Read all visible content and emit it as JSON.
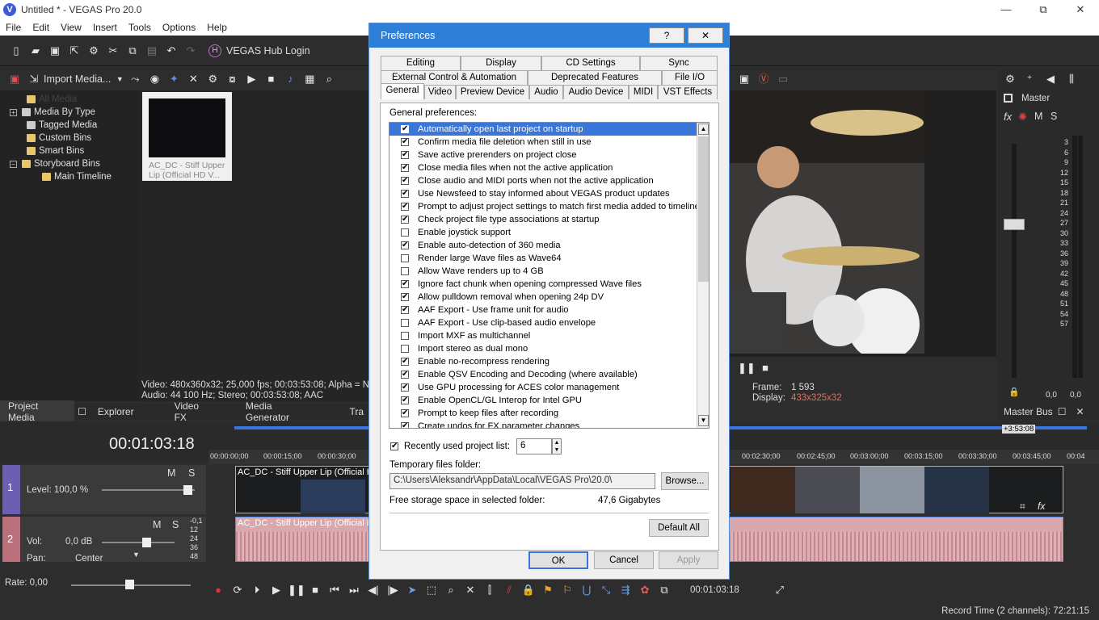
{
  "window": {
    "title": "Untitled * - VEGAS Pro 20.0",
    "logo": "V",
    "minimize": "—",
    "maximize": "⧉",
    "close": "✕"
  },
  "menu": [
    "File",
    "Edit",
    "View",
    "Insert",
    "Tools",
    "Options",
    "Help"
  ],
  "toolbar": {
    "hub_login": "VEGAS Hub Login",
    "hub_icon": "H"
  },
  "project_media": {
    "import_label": "Import Media...",
    "tree": [
      {
        "label": "All Media",
        "type": "folder",
        "indent": 0
      },
      {
        "label": "Media By Type",
        "type": "expand",
        "indent": 0
      },
      {
        "label": "Tagged Media",
        "type": "folder",
        "indent": 0
      },
      {
        "label": "Custom Bins",
        "type": "folder",
        "indent": 0
      },
      {
        "label": "Smart Bins",
        "type": "folder",
        "indent": 0
      },
      {
        "label": "Storyboard Bins",
        "type": "collapse",
        "indent": 0
      },
      {
        "label": "Main Timeline",
        "type": "folder",
        "indent": 1
      }
    ],
    "thumb_caption": "AC_DC - Stiff Upper Lip (Official HD V...",
    "info_video": "Video: 480x360x32; 25,000 fps; 00:03:53:08; Alpha = No",
    "info_audio": "Audio: 44 100 Hz; Stereo; 00:03:53:08; AAC"
  },
  "bottom_tabs": [
    "Project Media",
    "Explorer",
    "Video FX",
    "Media Generator",
    "Tra"
  ],
  "preview": {
    "frame_label": "Frame:",
    "frame_value": "1 593",
    "display_label": "Display:",
    "display_value": "433x325x32"
  },
  "mixer": {
    "title": "Master",
    "fx": "fx",
    "m": "M",
    "s": "S",
    "scale": [
      "3",
      "6",
      "9",
      "12",
      "15",
      "18",
      "21",
      "24",
      "27",
      "30",
      "33",
      "36",
      "39",
      "42",
      "45",
      "48",
      "51",
      "54",
      "57"
    ],
    "left_val": "0,0",
    "right_val": "0,0",
    "bus_tab": "Master Bus"
  },
  "timeline": {
    "timecode": "00:01:03:18",
    "end_marker": "+3:53:08",
    "ruler": [
      "00:00:00;00",
      "00:00:15;00",
      "00:00:30;00",
      "00:02:30;00",
      "00:02:45;00",
      "00:03:00;00",
      "00:03:15;00",
      "00:03:30;00",
      "00:03:45;00",
      "00:04"
    ],
    "track1": {
      "num": "1",
      "level": "Level: 100,0 %",
      "m": "M",
      "s": "S",
      "clip": "AC_DC - Stiff Upper Lip (Official H"
    },
    "track2": {
      "num": "2",
      "vol": "Vol:",
      "vol_val": "0,0 dB",
      "pan": "Pan:",
      "pan_val": "Center",
      "m": "M",
      "s": "S",
      "clip": "AC_DC - Stiff Upper Lip (Official H",
      "meter": [
        "-0,1",
        "12",
        "24",
        "36",
        "48"
      ]
    },
    "rate": "Rate: 0,00",
    "transport_time": "00:01:03:18"
  },
  "status": {
    "record_time": "Record Time (2 channels): 72:21:15"
  },
  "dialog": {
    "title": "Preferences",
    "help": "?",
    "close": "✕",
    "tabs_row1": [
      "Editing",
      "Display",
      "CD Settings",
      "Sync"
    ],
    "tabs_row2": [
      "External Control & Automation",
      "Deprecated Features",
      "File I/O"
    ],
    "tabs_row3": [
      "General",
      "Video",
      "Preview Device",
      "Audio",
      "Audio Device",
      "MIDI",
      "VST Effects"
    ],
    "section_label": "General preferences:",
    "items": [
      {
        "label": "Automatically open last project on startup",
        "checked": true,
        "selected": true
      },
      {
        "label": "Confirm media file deletion when still in use",
        "checked": true
      },
      {
        "label": "Save active prerenders on project close",
        "checked": true
      },
      {
        "label": "Close media files when not the active application",
        "checked": true
      },
      {
        "label": "Close audio and MIDI ports when not the active application",
        "checked": true
      },
      {
        "label": "Use Newsfeed to stay informed about VEGAS product updates",
        "checked": true
      },
      {
        "label": "Prompt to adjust project settings to match first media added to timeline",
        "checked": true
      },
      {
        "label": "Check project file type associations at startup",
        "checked": true
      },
      {
        "label": "Enable joystick support",
        "checked": false
      },
      {
        "label": "Enable auto-detection of 360 media",
        "checked": true
      },
      {
        "label": "Render large Wave files as Wave64",
        "checked": false
      },
      {
        "label": "Allow Wave renders up to 4 GB",
        "checked": false
      },
      {
        "label": "Ignore fact chunk when opening compressed Wave files",
        "checked": true
      },
      {
        "label": "Allow pulldown removal when opening 24p DV",
        "checked": true
      },
      {
        "label": "AAF Export - Use frame unit for audio",
        "checked": true
      },
      {
        "label": "AAF Export - Use clip-based audio envelope",
        "checked": false
      },
      {
        "label": "Import MXF as multichannel",
        "checked": false
      },
      {
        "label": "Import stereo as dual mono",
        "checked": false
      },
      {
        "label": "Enable no-recompress rendering",
        "checked": true
      },
      {
        "label": "Enable QSV Encoding and Decoding (where available)",
        "checked": true
      },
      {
        "label": "Use GPU processing for ACES color management",
        "checked": true
      },
      {
        "label": "Enable OpenCL/GL Interop for Intel GPU",
        "checked": true
      },
      {
        "label": "Prompt to keep files after recording",
        "checked": true
      },
      {
        "label": "Create undos for FX parameter changes",
        "checked": true
      }
    ],
    "recent_label": "Recently used project list:",
    "recent_checked": true,
    "recent_value": "6",
    "temp_label": "Temporary files folder:",
    "temp_value": "C:\\Users\\Aleksandr\\AppData\\Local\\VEGAS Pro\\20.0\\",
    "browse": "Browse...",
    "free_label": "Free storage space in selected folder:",
    "free_value": "47,6 Gigabytes",
    "default_all": "Default All",
    "ok": "OK",
    "cancel": "Cancel",
    "apply": "Apply"
  },
  "colors": {
    "accent": "#2e7fd8",
    "selection": "#3a75d8",
    "video_clip_border": "#b9c73d",
    "audio_clip": "#d9a8ae",
    "track_purple": "#6a5fb0"
  }
}
